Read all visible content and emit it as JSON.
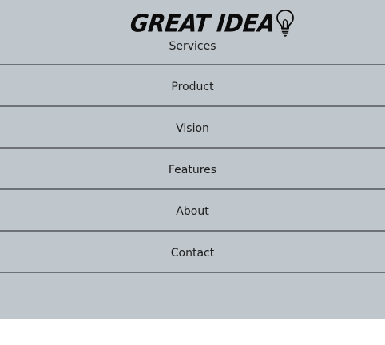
{
  "brand": {
    "logo_text": "GREAT IDEA",
    "logo_icon": "lightbulb-icon"
  },
  "menu": {
    "items": [
      {
        "label": "Services"
      },
      {
        "label": "Product"
      },
      {
        "label": "Vision"
      },
      {
        "label": "Features"
      },
      {
        "label": "About"
      },
      {
        "label": "Contact"
      }
    ]
  },
  "colors": {
    "panel_background": "#bfc6cc",
    "divider": "#6e7175",
    "text": "#1d1d1d",
    "logo": "#0b0b0b"
  }
}
